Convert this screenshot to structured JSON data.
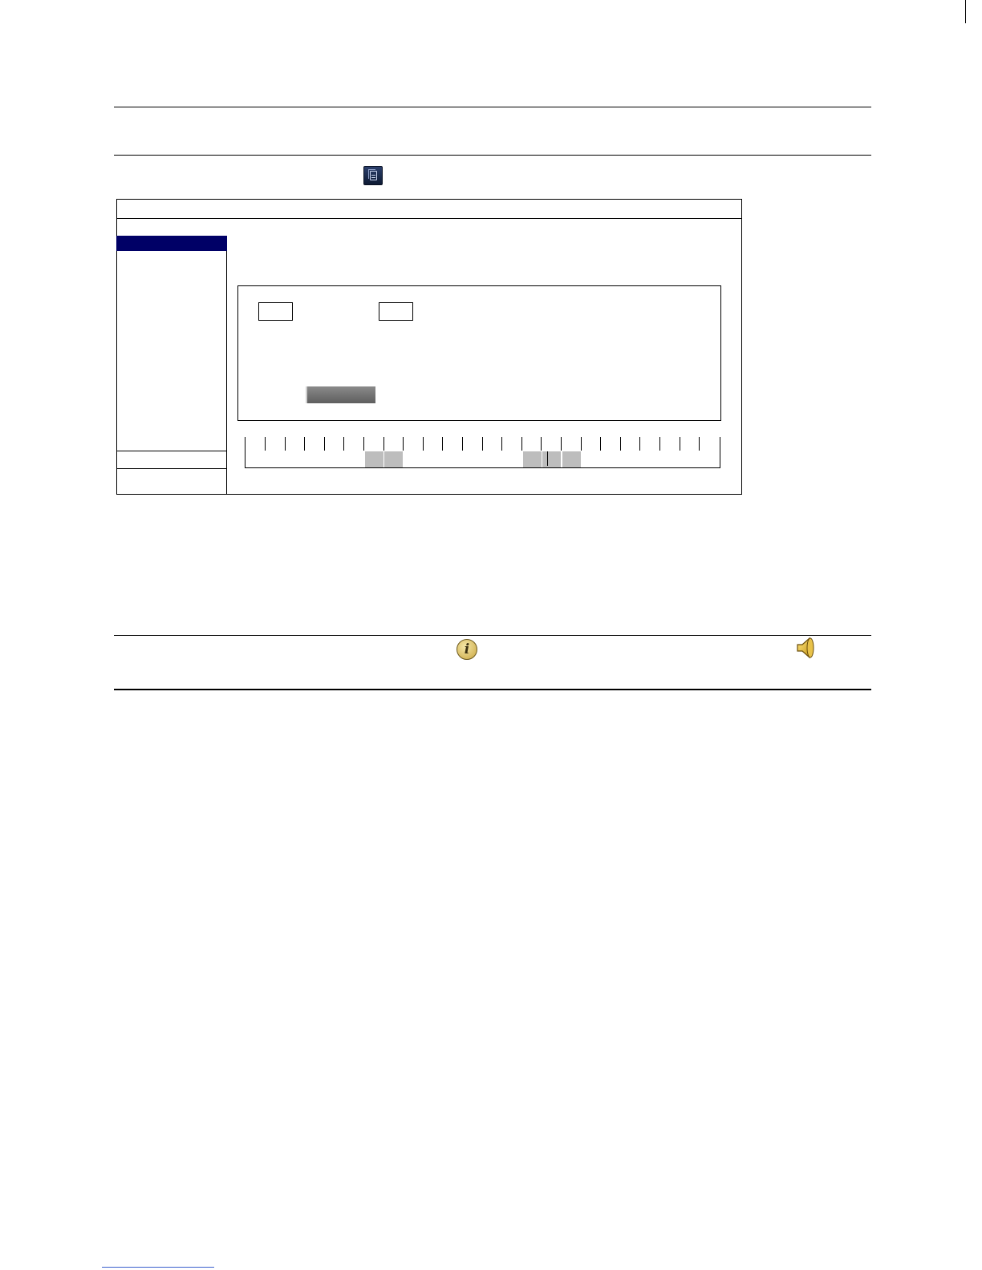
{
  "icons": {
    "document": "document-icon",
    "info": "info-icon",
    "speaker": "speaker-icon",
    "info_glyph": "i"
  },
  "colors": {
    "selected_item": "#000066",
    "timeline_block": "#bdbdbd",
    "button": "#6e6e6e",
    "link_underline": "#3a5fcd"
  }
}
